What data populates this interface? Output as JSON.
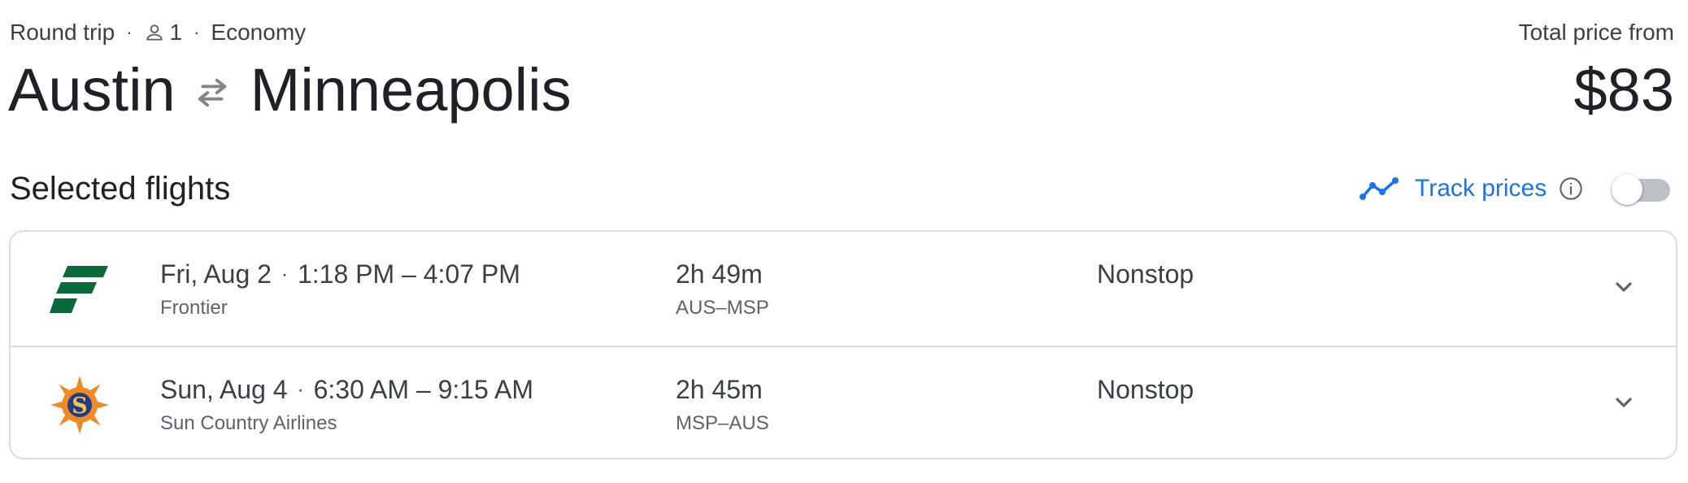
{
  "header": {
    "trip_type": "Round trip",
    "passengers": "1",
    "cabin": "Economy",
    "origin": "Austin",
    "destination": "Minneapolis",
    "price_label": "Total price from",
    "price": "$83"
  },
  "section": {
    "title": "Selected flights",
    "track_prices_label": "Track prices",
    "track_prices_enabled": false
  },
  "flights": [
    {
      "date": "Fri, Aug 2",
      "time_range": "1:18 PM – 4:07 PM",
      "airline": "Frontier",
      "duration": "2h 49m",
      "route": "AUS–MSP",
      "stops": "Nonstop",
      "logo_icon": "frontier-logo-icon"
    },
    {
      "date": "Sun, Aug 4",
      "time_range": "6:30 AM – 9:15 AM",
      "airline": "Sun Country Airlines",
      "duration": "2h 45m",
      "route": "MSP–AUS",
      "stops": "Nonstop",
      "logo_icon": "sun-country-logo-icon"
    }
  ],
  "colors": {
    "accent": "#1a73e8",
    "text_primary": "#202124",
    "text_secondary": "#5f6368",
    "border": "#dadce0",
    "frontier_green": "#0a6b3a",
    "sun_country_orange": "#f08a24",
    "sun_country_navy": "#1f3c88"
  }
}
